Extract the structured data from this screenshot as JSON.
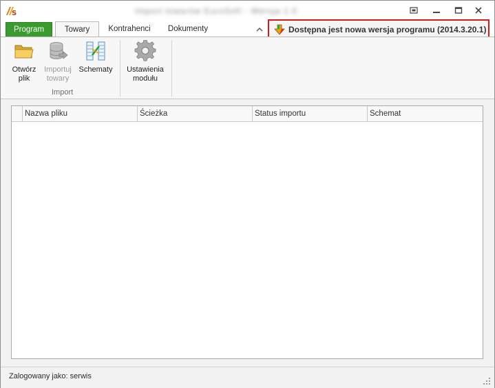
{
  "window": {
    "title": "Import towarów EuroSoft - Wersja 1.0",
    "icons": {
      "app": "app-logo-icon",
      "restore": "restore-icon",
      "minimize": "minimize-icon",
      "maximize": "maximize-icon",
      "close": "close-icon"
    }
  },
  "tabs": [
    {
      "label": "Program"
    },
    {
      "label": "Towary"
    },
    {
      "label": "Kontrahenci"
    },
    {
      "label": "Dokumenty"
    }
  ],
  "update_notice": {
    "text": "Dostępna jest nowa wersja programu (2014.3.20.1)",
    "icon": "download-arrow-icon",
    "highlight_color": "#d21c1c"
  },
  "ribbon": {
    "buttons": {
      "open": {
        "label": "Otwórz plik",
        "icon": "folder-icon",
        "enabled": true
      },
      "import": {
        "label": "Importuj towary",
        "icon": "database-import-icon",
        "enabled": false
      },
      "schemes": {
        "label": "Schematy",
        "icon": "schema-icon",
        "enabled": true
      },
      "settings": {
        "label": "Ustawienia modułu",
        "icon": "gear-icon",
        "enabled": true
      }
    },
    "groups": {
      "import": "Import"
    }
  },
  "grid": {
    "columns": [
      "Nazwa pliku",
      "Ścieżka",
      "Status importu",
      "Schemat"
    ],
    "rows": []
  },
  "status": {
    "logged_in": "Zalogowany jako: serwis"
  },
  "colors": {
    "program_tab": "#3a9b2e",
    "ribbon_bg": "#f7f7f7"
  }
}
